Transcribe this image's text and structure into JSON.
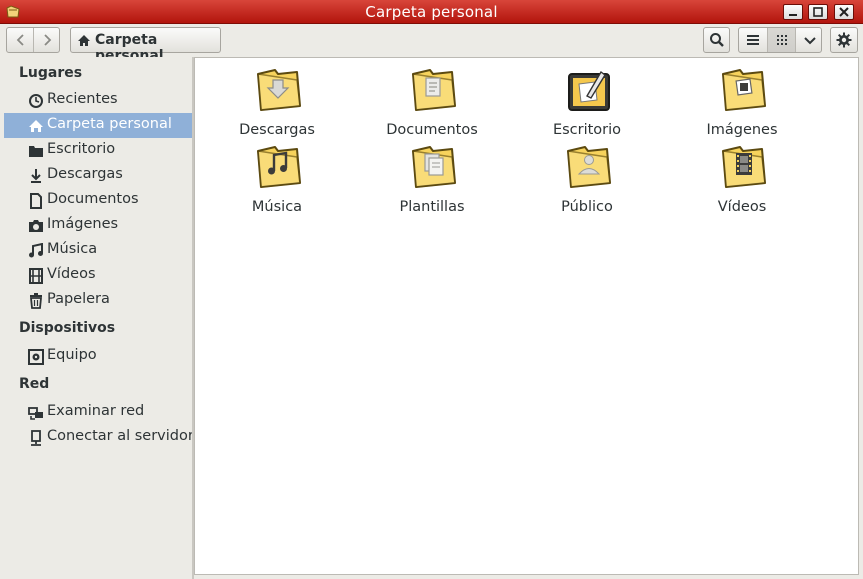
{
  "window": {
    "title": "Carpeta personal"
  },
  "toolbar": {
    "path_label": "Carpeta personal"
  },
  "sidebar": {
    "sections": [
      {
        "heading": "Lugares",
        "items": [
          {
            "label": "Recientes",
            "icon": "clock-icon"
          },
          {
            "label": "Carpeta personal",
            "icon": "home-icon",
            "selected": true
          },
          {
            "label": "Escritorio",
            "icon": "folder-icon"
          },
          {
            "label": "Descargas",
            "icon": "download-icon"
          },
          {
            "label": "Documentos",
            "icon": "document-icon"
          },
          {
            "label": "Imágenes",
            "icon": "camera-icon"
          },
          {
            "label": "Música",
            "icon": "music-icon"
          },
          {
            "label": "Vídeos",
            "icon": "film-icon"
          },
          {
            "label": "Papelera",
            "icon": "trash-icon"
          }
        ]
      },
      {
        "heading": "Dispositivos",
        "items": [
          {
            "label": "Equipo",
            "icon": "computer-icon"
          }
        ]
      },
      {
        "heading": "Red",
        "items": [
          {
            "label": "Examinar red",
            "icon": "network-icon"
          },
          {
            "label": "Conectar al servidor",
            "icon": "server-icon"
          }
        ]
      }
    ]
  },
  "files": [
    {
      "label": "Descargas",
      "icon": "download-folder-icon"
    },
    {
      "label": "Documentos",
      "icon": "documents-folder-icon"
    },
    {
      "label": "Escritorio",
      "icon": "desktop-folder-icon"
    },
    {
      "label": "Imágenes",
      "icon": "pictures-folder-icon"
    },
    {
      "label": "Música",
      "icon": "music-folder-icon"
    },
    {
      "label": "Plantillas",
      "icon": "templates-folder-icon"
    },
    {
      "label": "Público",
      "icon": "public-folder-icon"
    },
    {
      "label": "Vídeos",
      "icon": "videos-folder-icon"
    }
  ],
  "colors": {
    "titlebar": "#c52c22",
    "selection": "#8fb0d8",
    "folder": "#f7d35c"
  }
}
